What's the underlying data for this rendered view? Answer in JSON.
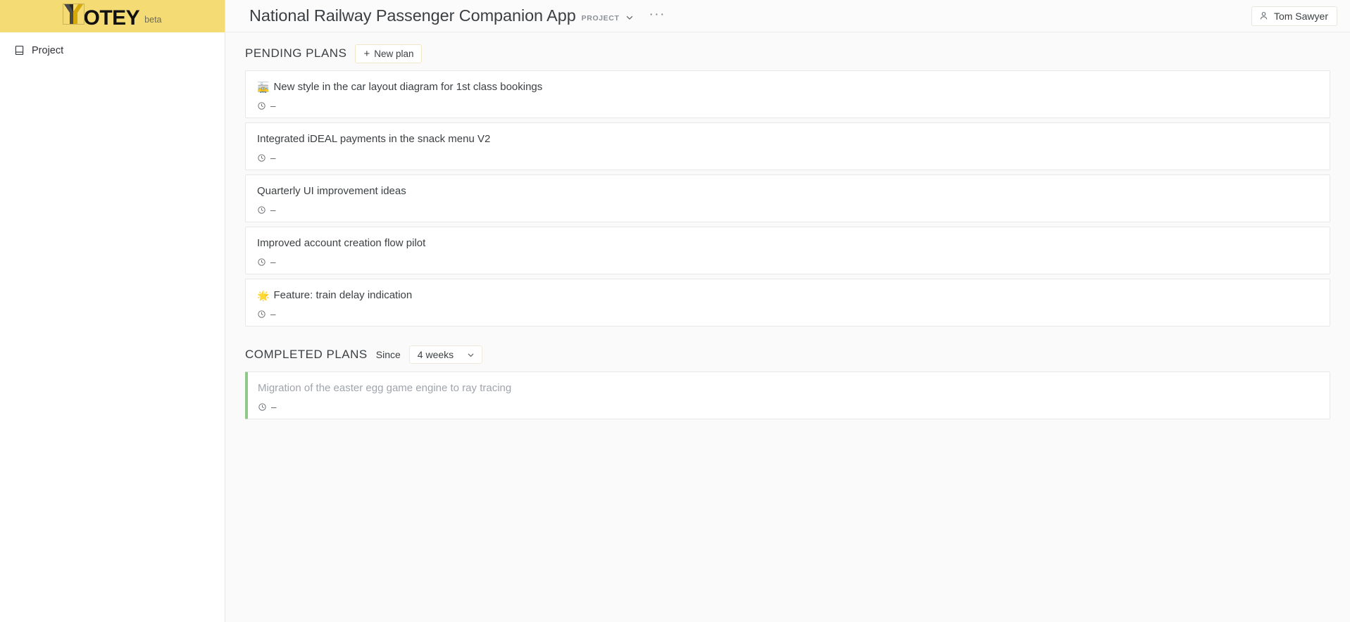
{
  "brand": {
    "logo_mark": "y-logo-icon",
    "logo_word": "OTEY",
    "beta_label": "beta",
    "logo_bg": "#f5db74",
    "logo_gold": "#d6a709",
    "logo_dark": "#262626"
  },
  "sidebar": {
    "items": [
      {
        "icon": "book-icon",
        "label": "Project"
      }
    ]
  },
  "topbar": {
    "title": "National Railway Passenger Companion App",
    "kind": "PROJECT",
    "chevron_icon": "chevron-down-icon",
    "overflow_icon": "ellipsis-icon",
    "overflow_label": "···",
    "user": {
      "icon": "person-icon",
      "name": "Tom Sawyer"
    }
  },
  "pending": {
    "title": "PENDING PLANS",
    "new_plan_label": "New plan",
    "new_plan_plus": "+",
    "plans": [
      {
        "emoji": "🚋",
        "emoji_name": "tram-car-emoji",
        "title": "New style in the car layout diagram for 1st class bookings",
        "meta_icon": "clock-icon",
        "meta": "–"
      },
      {
        "emoji": "",
        "emoji_name": "",
        "title": "Integrated iDEAL payments in the snack menu V2",
        "meta_icon": "clock-icon",
        "meta": "–"
      },
      {
        "emoji": "",
        "emoji_name": "",
        "title": "Quarterly UI improvement ideas",
        "meta_icon": "clock-icon",
        "meta": "–"
      },
      {
        "emoji": "",
        "emoji_name": "",
        "title": "Improved account creation flow pilot",
        "meta_icon": "clock-icon",
        "meta": "–"
      },
      {
        "emoji": "🌟",
        "emoji_name": "glowing-star-emoji",
        "title": "Feature: train delay indication",
        "meta_icon": "clock-icon",
        "meta": "–"
      }
    ]
  },
  "completed": {
    "title": "COMPLETED PLANS",
    "since_label": "Since",
    "since_value": "4 weeks",
    "since_options": [
      "4 weeks"
    ],
    "chevron_icon": "chevron-down-icon",
    "accent_color": "#8ec98a",
    "plans": [
      {
        "title": "Migration of the easter egg game engine to ray tracing",
        "meta_icon": "clock-icon",
        "meta": "–"
      }
    ]
  }
}
